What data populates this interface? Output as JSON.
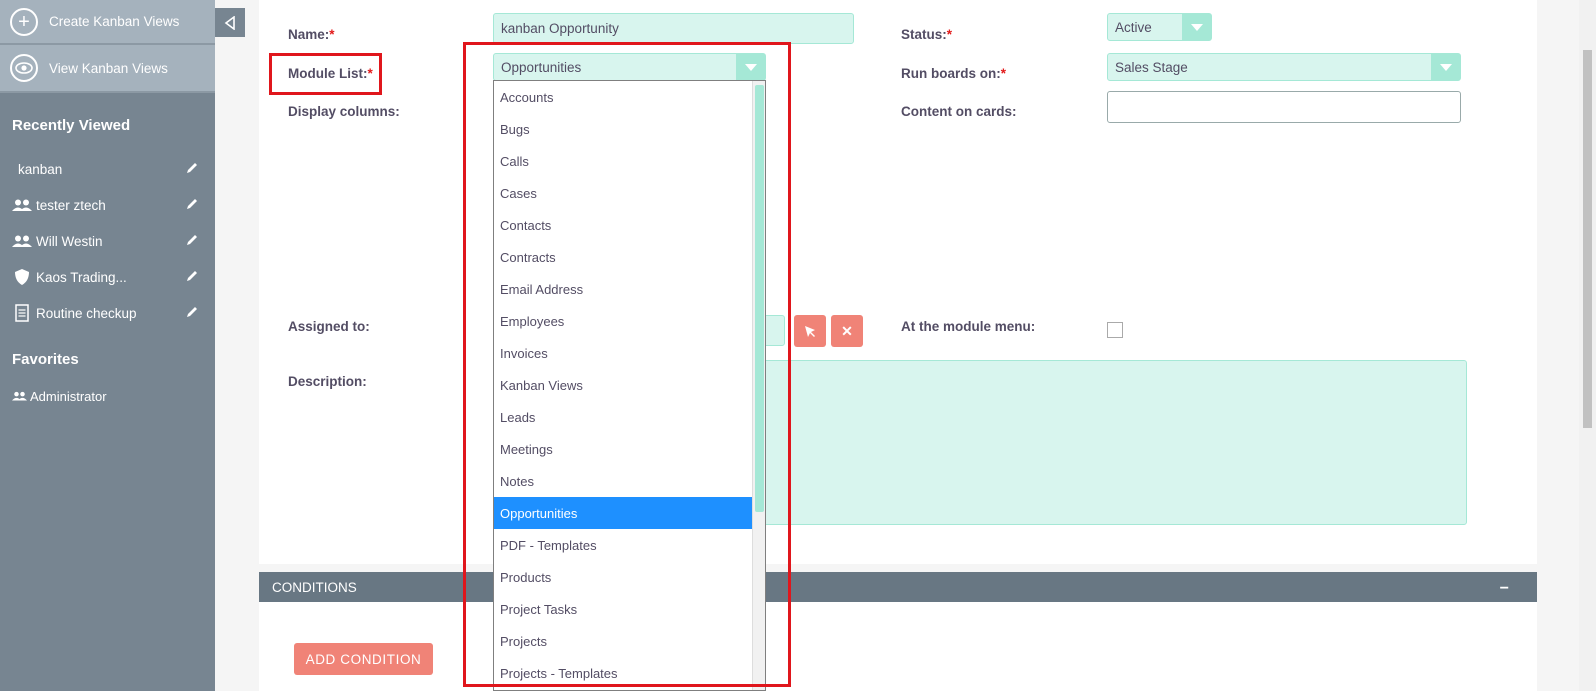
{
  "sidebar": {
    "actions": [
      {
        "label": "Create Kanban Views",
        "icon": "plus-circle-icon"
      },
      {
        "label": "View Kanban Views",
        "icon": "eye-icon"
      }
    ],
    "recently_viewed_title": "Recently Viewed",
    "recently_viewed": [
      {
        "label": "kanban",
        "icon": ""
      },
      {
        "label": "tester ztech",
        "icon": "users-icon"
      },
      {
        "label": "Will Westin",
        "icon": "users-icon"
      },
      {
        "label": "Kaos Trading...",
        "icon": "shield-icon"
      },
      {
        "label": "Routine checkup",
        "icon": "document-icon"
      }
    ],
    "favorites_title": "Favorites",
    "favorites": [
      {
        "label": "Administrator",
        "icon": "users-icon"
      }
    ]
  },
  "form": {
    "name_label": "Name:",
    "name_value": "kanban Opportunity",
    "status_label": "Status:",
    "status_value": "Active",
    "module_list_label": "Module List:",
    "module_list_value": "Opportunities",
    "run_boards_label": "Run boards on:",
    "run_boards_value": "Sales Stage",
    "display_columns_label": "Display columns:",
    "content_on_cards_label": "Content on cards:",
    "assigned_to_label": "Assigned to:",
    "at_module_menu_label": "At the module menu:",
    "description_label": "Description:",
    "required_mark": "*"
  },
  "conditions": {
    "title": "CONDITIONS",
    "collapse_symbol": "−",
    "add_button": "ADD CONDITION"
  },
  "dropdown": {
    "options": [
      "Accounts",
      "Bugs",
      "Calls",
      "Cases",
      "Contacts",
      "Contracts",
      "Email Address",
      "Employees",
      "Invoices",
      "Kanban Views",
      "Leads",
      "Meetings",
      "Notes",
      "Opportunities",
      "PDF - Templates",
      "Products",
      "Project Tasks",
      "Projects",
      "Projects - Templates"
    ],
    "selected": "Opportunities"
  },
  "colors": {
    "sidebar": "#778591",
    "accent_green": "#a5e8d6",
    "button_salmon": "#f08377",
    "highlight_red": "#e0161c",
    "selected_blue": "#1e90ff"
  }
}
